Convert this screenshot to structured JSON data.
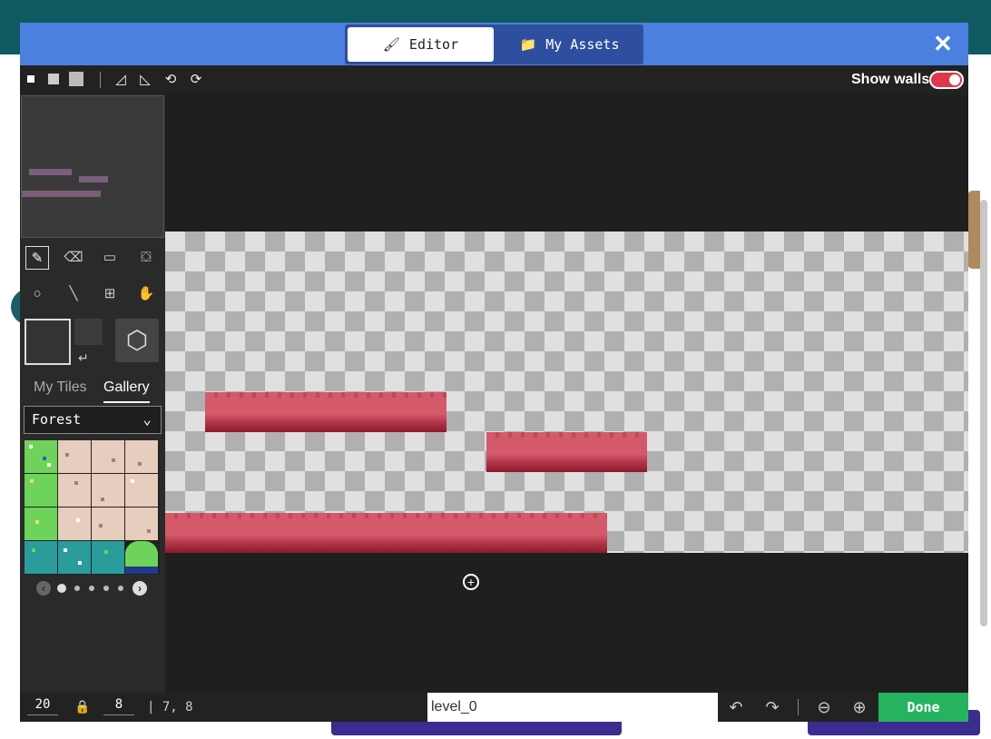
{
  "header": {
    "tabs": [
      {
        "label": "Editor",
        "icon": "paintbrush-icon",
        "active": true
      },
      {
        "label": "My Assets",
        "icon": "folder-icon",
        "active": false
      }
    ],
    "close_icon": "close-icon"
  },
  "toolbar": {
    "brush_sizes": [
      "small",
      "medium",
      "large"
    ],
    "rotate_tools": [
      "flip-horizontal-icon",
      "flip-vertical-icon",
      "rotate-left-icon",
      "rotate-right-icon"
    ],
    "show_walls_label": "Show walls",
    "show_walls_on": true,
    "toggle_color": "#e0384b"
  },
  "sidebar": {
    "tools": [
      "pencil-icon",
      "eraser-icon",
      "rectangle-icon",
      "fill-icon",
      "circle-icon",
      "line-icon",
      "marquee-icon",
      "pan-icon"
    ],
    "active_tool": "pencil-icon",
    "tabs": {
      "my_tiles": "My Tiles",
      "gallery": "Gallery",
      "active": "Gallery"
    },
    "gallery_category": "Forest",
    "pager": {
      "pages": 5,
      "current": 1
    }
  },
  "canvas": {
    "wall_color": "#d45a6a"
  },
  "footer": {
    "width_value": "20",
    "height_value": "8",
    "coordinates": "7, 8",
    "level_name": "level_0",
    "done_label": "Done",
    "done_color": "#25b35f"
  }
}
